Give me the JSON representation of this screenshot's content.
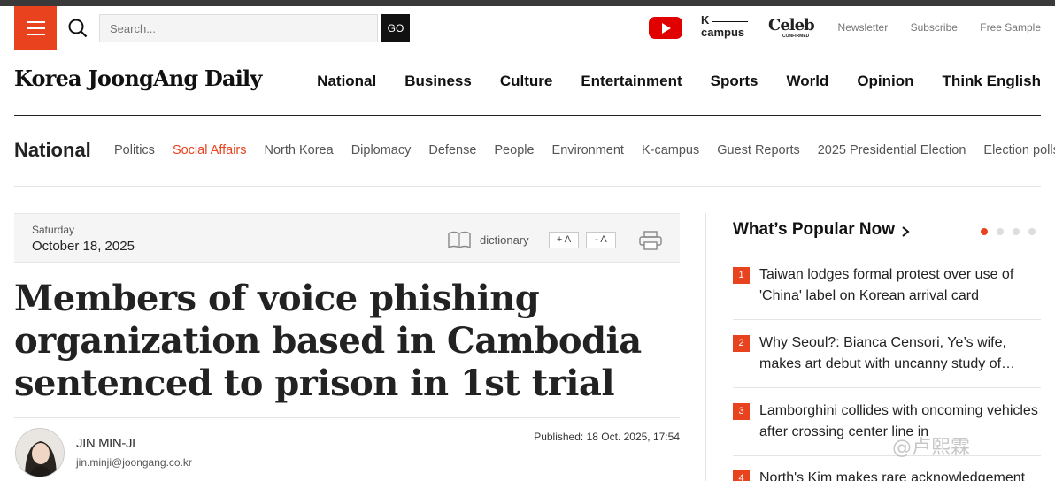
{
  "header": {
    "search_placeholder": "Search...",
    "go_label": "GO",
    "icons": {
      "menu": "hamburger-icon",
      "search": "magnifier-icon",
      "youtube": "youtube-play-icon"
    },
    "brand_kcampus_top": "K",
    "brand_kcampus_bottom": "campus",
    "brand_celeb": "Celeb",
    "brand_celeb_sub": "CONFIRMED",
    "links": [
      "Newsletter",
      "Subscribe",
      "Free Sample"
    ]
  },
  "site": {
    "logo": "Korea JoongAng Daily",
    "nav": [
      "National",
      "Business",
      "Culture",
      "Entertainment",
      "Sports",
      "World",
      "Opinion",
      "Think English"
    ]
  },
  "section": {
    "title": "National",
    "subnav": [
      "Politics",
      "Social Affairs",
      "North Korea",
      "Diplomacy",
      "Defense",
      "People",
      "Environment",
      "K-campus",
      "Guest Reports",
      "2025 Presidential Election",
      "Election polls"
    ],
    "active": "Social Affairs"
  },
  "article": {
    "day": "Saturday",
    "date": "October 18, 2025",
    "dictionary_label": "dictionary",
    "font_increase": "+ A",
    "font_decrease": "- A",
    "headline": "Members of voice phishing organization based in Cambodia sentenced to prison in 1st trial",
    "author_name": "JIN MIN-JI",
    "author_email": "jin.minji@joongang.co.kr",
    "published": "Published: 18 Oct. 2025, 17:54"
  },
  "sidebar": {
    "title": "What’s Popular Now",
    "items": [
      {
        "num": "1",
        "text": "Taiwan lodges formal protest over use of 'China' label on Korean arrival card"
      },
      {
        "num": "2",
        "text": "Why Seoul?: Bianca Censori, Ye’s wife, makes art debut with uncanny study of…"
      },
      {
        "num": "3",
        "text": "Lamborghini collides with oncoming vehicles after crossing center line in"
      },
      {
        "num": "4",
        "text": "North's Kim makes rare acknowledgement"
      }
    ]
  },
  "watermark": "@卢熙霖",
  "colors": {
    "accent": "#e8421f",
    "dark": "#111111"
  }
}
